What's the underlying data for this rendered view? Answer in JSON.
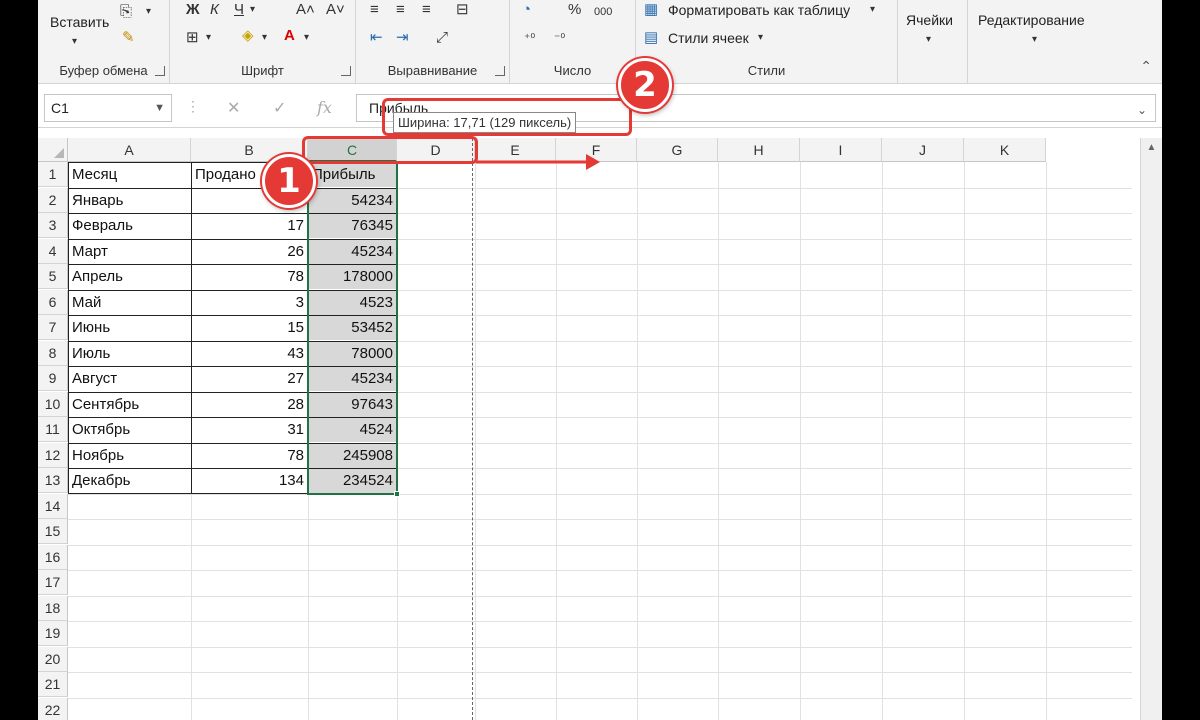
{
  "ribbon": {
    "clipboard": {
      "paste_label": "Вставить",
      "group_label": "Буфер обмена"
    },
    "font": {
      "bold": "Ж",
      "italic": "К",
      "underline": "Ч",
      "group_label": "Шрифт"
    },
    "alignment": {
      "group_label": "Выравнивание"
    },
    "number": {
      "percent": "%",
      "thousands": "000",
      "group_label": "Число"
    },
    "styles": {
      "format_as_table": "Форматировать как таблицу",
      "cell_styles": "Стили ячеек",
      "group_label": "Стили"
    },
    "cells": {
      "label": "Ячейки"
    },
    "editing": {
      "label": "Редактирование"
    }
  },
  "formula_bar": {
    "name_box": "C1",
    "formula_value": "Прибыль",
    "fx": "fx"
  },
  "tooltip": "Ширина: 17,71 (129 пиксель)",
  "annotations": {
    "badge1": "1",
    "badge2": "2"
  },
  "columns": [
    "A",
    "B",
    "C",
    "D",
    "E",
    "F",
    "G",
    "H",
    "I",
    "J",
    "K"
  ],
  "rows": [
    "1",
    "2",
    "3",
    "4",
    "5",
    "6",
    "7",
    "8",
    "9",
    "10",
    "11",
    "12",
    "13",
    "14",
    "15",
    "16",
    "17",
    "18",
    "19",
    "20",
    "21",
    "22"
  ],
  "table": {
    "headers": [
      "Месяц",
      "Продано",
      "Прибыль"
    ],
    "rows": [
      [
        "Январь",
        "",
        "54234"
      ],
      [
        "Февраль",
        "17",
        "76345"
      ],
      [
        "Март",
        "26",
        "45234"
      ],
      [
        "Апрель",
        "78",
        "178000"
      ],
      [
        "Май",
        "3",
        "4523"
      ],
      [
        "Июнь",
        "15",
        "53452"
      ],
      [
        "Июль",
        "43",
        "78000"
      ],
      [
        "Август",
        "27",
        "45234"
      ],
      [
        "Сентябрь",
        "28",
        "97643"
      ],
      [
        "Октябрь",
        "31",
        "4524"
      ],
      [
        "Ноябрь",
        "78",
        "245908"
      ],
      [
        "Декабрь",
        "134",
        "234524"
      ]
    ]
  },
  "colors": {
    "selection": "#217346",
    "annotation": "#e53935"
  }
}
